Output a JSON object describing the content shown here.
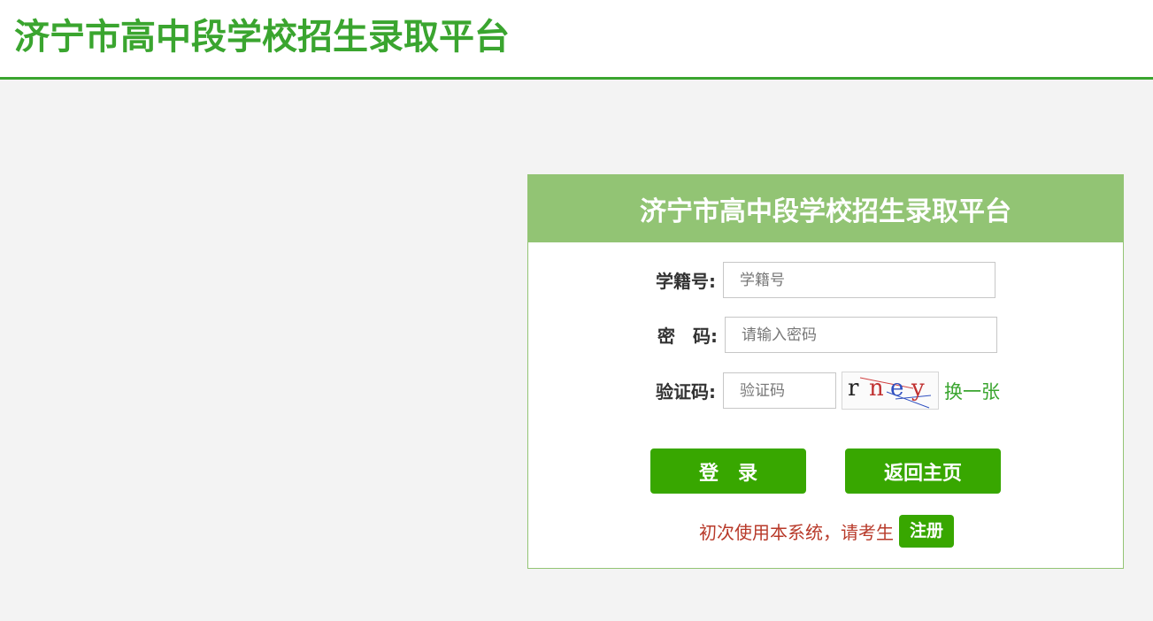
{
  "header": {
    "title": "济宁市高中段学校招生录取平台"
  },
  "login": {
    "title": "济宁市高中段学校招生录取平台",
    "student_id": {
      "label": "学籍号:",
      "placeholder": "学籍号"
    },
    "password": {
      "label": "密　码:",
      "placeholder": "请输入密码"
    },
    "captcha": {
      "label": "验证码:",
      "placeholder": "验证码",
      "chars": [
        "r",
        "n",
        "e",
        "y"
      ],
      "refresh_label": "换一张"
    },
    "login_button": "登　录",
    "home_button": "返回主页",
    "register_prompt": "初次使用本系统，请考生",
    "register_button": "注册"
  },
  "colors": {
    "brand_green": "#3aa52f",
    "panel_header": "#92c474",
    "button_green": "#38a700",
    "prompt_red": "#b83a2a"
  }
}
